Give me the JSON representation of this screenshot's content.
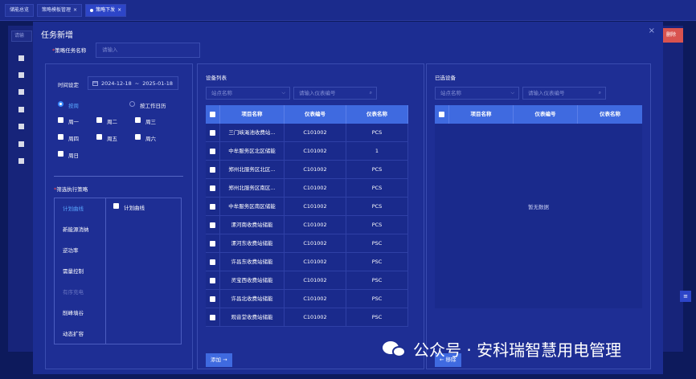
{
  "topbar": {
    "tabs": [
      {
        "label": "储能总览",
        "closable": false,
        "active": false
      },
      {
        "label": "策略模板管理",
        "closable": true,
        "active": false
      },
      {
        "label": "策略下发",
        "closable": true,
        "active": true
      }
    ]
  },
  "background": {
    "search_placeholder": "请输",
    "delete_label": "删除",
    "side_icon": "≡"
  },
  "modal": {
    "title": "任务新增",
    "close_icon": "×",
    "task_name": {
      "required_mark": "*",
      "label": "策略任务名称",
      "placeholder": "请输入"
    },
    "time": {
      "label": "时间设定",
      "calendar_icon": "calendar-icon",
      "start": "2024-12-18",
      "separator": "~",
      "end": "2025-01-18",
      "modes": [
        {
          "label": "按周",
          "selected": true
        },
        {
          "label": "按工作日历",
          "selected": false
        }
      ],
      "weekdays": [
        "周一",
        "周二",
        "周三",
        "周四",
        "周五",
        "周六",
        "周日"
      ]
    },
    "strategy": {
      "required_mark": "*",
      "label": "筛选执行策略",
      "items": [
        {
          "label": "计划曲线",
          "state": "active"
        },
        {
          "label": "新能源消纳",
          "state": "normal"
        },
        {
          "label": "逆功率",
          "state": "normal"
        },
        {
          "label": "需量控制",
          "state": "normal"
        },
        {
          "label": "有序充电",
          "state": "disabled"
        },
        {
          "label": "削峰填谷",
          "state": "normal"
        },
        {
          "label": "动态扩容",
          "state": "normal"
        }
      ],
      "option_label": "计划曲线"
    },
    "device_list": {
      "title": "设备列表",
      "site_placeholder": "站点名称",
      "meter_placeholder": "请输入仪表编号",
      "columns": [
        "项目名称",
        "仪表编号",
        "仪表名称"
      ],
      "rows": [
        [
          "三门峡渑池收费站...",
          "C101002",
          "PCS"
        ],
        [
          "中牟服务区北区储能",
          "C101002",
          "1"
        ],
        [
          "郑州北服务区北区...",
          "C101002",
          "PCS"
        ],
        [
          "郑州北服务区南区...",
          "C101002",
          "PCS"
        ],
        [
          "中牟服务区南区储能",
          "C101002",
          "PCS"
        ],
        [
          "漯河南收费站储能",
          "C101002",
          "PCS"
        ],
        [
          "漯河东收费站储能",
          "C101002",
          "PSC"
        ],
        [
          "许昌东收费站储能",
          "C101002",
          "PSC"
        ],
        [
          "灵宝西收费站储能",
          "C101002",
          "PSC"
        ],
        [
          "许昌北收费站储能",
          "C101002",
          "PSC"
        ],
        [
          "观音堂收费站储能",
          "C101002",
          "PSC"
        ]
      ],
      "add_button": "添加 →"
    },
    "selected": {
      "title": "已选设备",
      "site_placeholder": "站点名称",
      "meter_placeholder": "请输入仪表编号",
      "columns": [
        "项目名称",
        "仪表编号",
        "仪表名称"
      ],
      "empty_text": "暂无数据",
      "remove_button": "← 移除"
    }
  },
  "watermark": {
    "text": "公众号 · 安科瑞智慧用电管理",
    "icon": "wechat-icon"
  }
}
